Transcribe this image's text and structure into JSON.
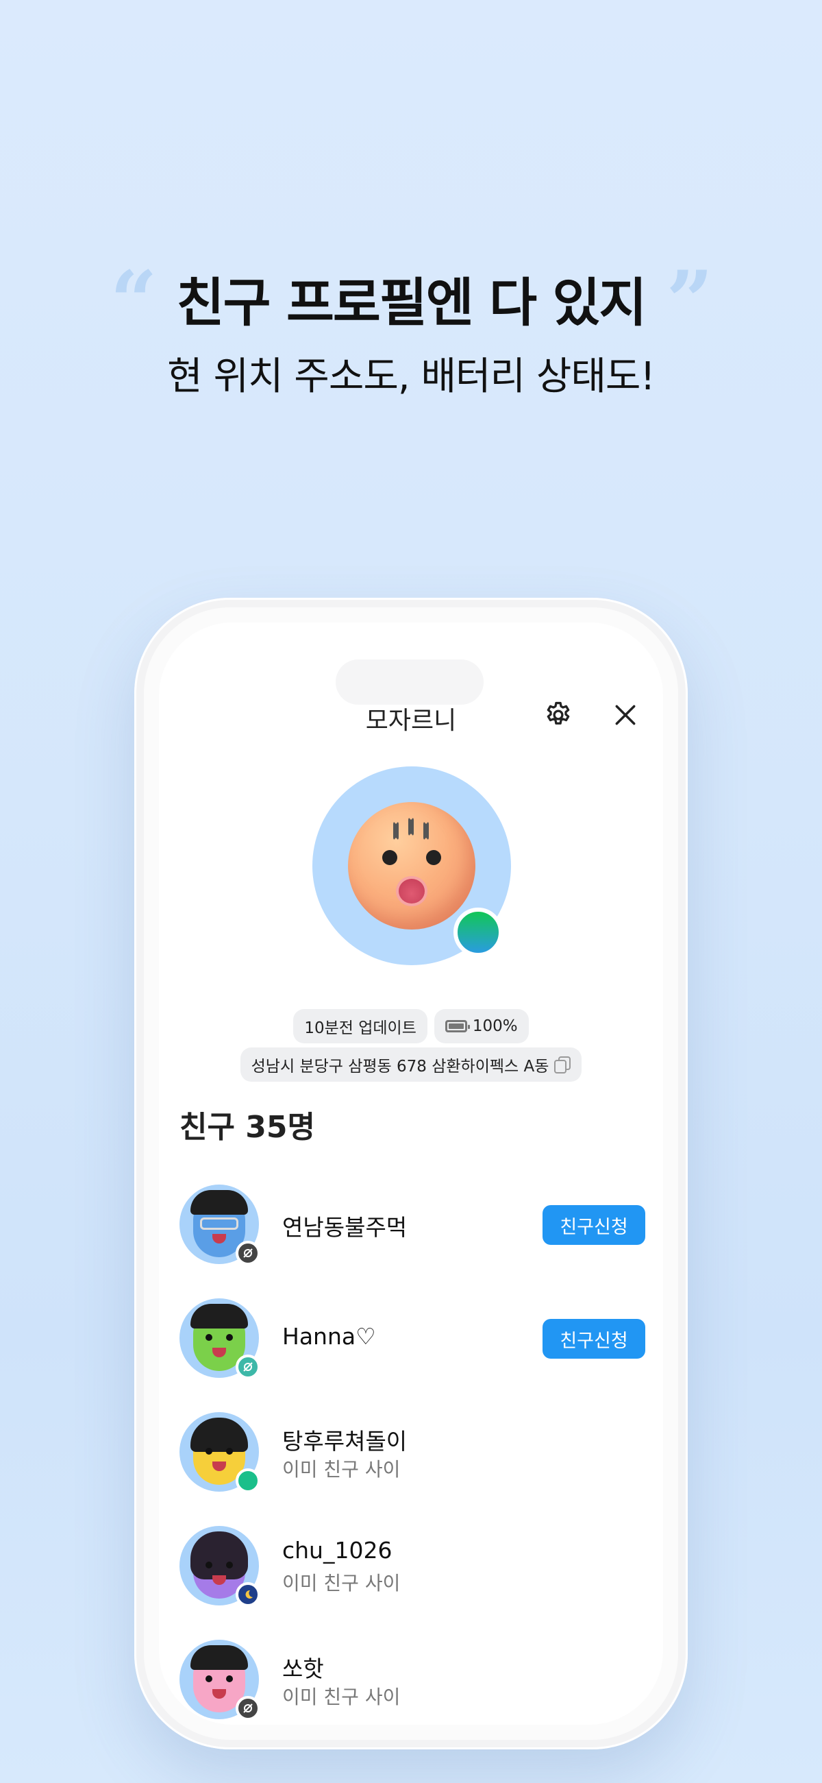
{
  "headline": {
    "open_quote": "“",
    "title": "친구 프로필엔 다 있지",
    "close_quote": "”",
    "subtitle": "현 위치 주소도, 배터리 상태도!"
  },
  "profile": {
    "name": "모자르니",
    "update_time": "10분전 업데이트",
    "battery": "100%",
    "address": "성남시 분당구 삼평동 678 삼환하이펙스 A동"
  },
  "friends": {
    "title": "친구 35명",
    "items": [
      {
        "name": "연남동불주먹",
        "subtitle": "",
        "action": "친구신청",
        "status": "offline"
      },
      {
        "name": "Hanna♡",
        "subtitle": "",
        "action": "친구신청",
        "status": "offline-teal"
      },
      {
        "name": "탕후루쳐돌이",
        "subtitle": "이미 친구 사이",
        "action": "",
        "status": "online"
      },
      {
        "name": "chu_1026",
        "subtitle": "이미 친구 사이",
        "action": "",
        "status": "sleeping"
      },
      {
        "name": "쏘핫",
        "subtitle": "이미 친구 사이",
        "action": "",
        "status": "offline"
      }
    ]
  },
  "colors": {
    "accent": "#2196f3",
    "background": "#dbeafd",
    "online": "#12c656"
  }
}
